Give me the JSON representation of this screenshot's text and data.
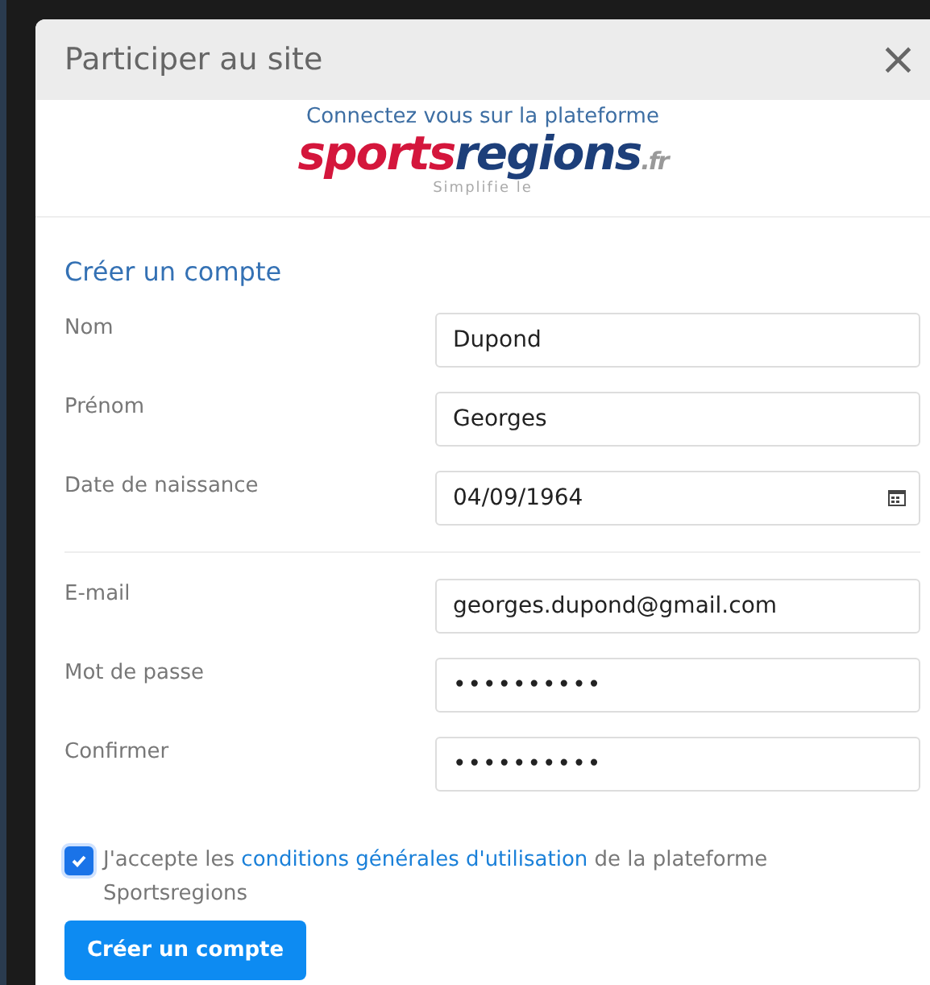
{
  "dialog": {
    "title": "Participer au site",
    "close": "×"
  },
  "header": {
    "intro": "Connectez vous sur la plateforme",
    "logo": {
      "part_1": "sports",
      "part_2": "regions",
      "suffix": ".fr",
      "tagline": "Simplifie le"
    }
  },
  "form": {
    "heading": "Créer un compte",
    "groups": [
      [
        {
          "label": "Nom",
          "value": "Dupond",
          "kind": "text"
        },
        {
          "label": "Prénom",
          "value": "Georges",
          "kind": "text"
        },
        {
          "label": "Date de naissance",
          "value": "04/09/1964",
          "kind": "date"
        }
      ],
      [
        {
          "label": "E-mail",
          "value": "georges.dupond@gmail.com",
          "kind": "text"
        },
        {
          "label": "Mot de passe",
          "value": "••••••••••",
          "kind": "password"
        },
        {
          "label": "Confirmer",
          "value": "••••••••••",
          "kind": "password"
        }
      ]
    ],
    "terms": {
      "checked": true,
      "before": "J'accepte les ",
      "link": "conditions générales d'utilisation",
      "after": " de la plateforme Sportsregions"
    },
    "submit": "Créer un compte"
  }
}
